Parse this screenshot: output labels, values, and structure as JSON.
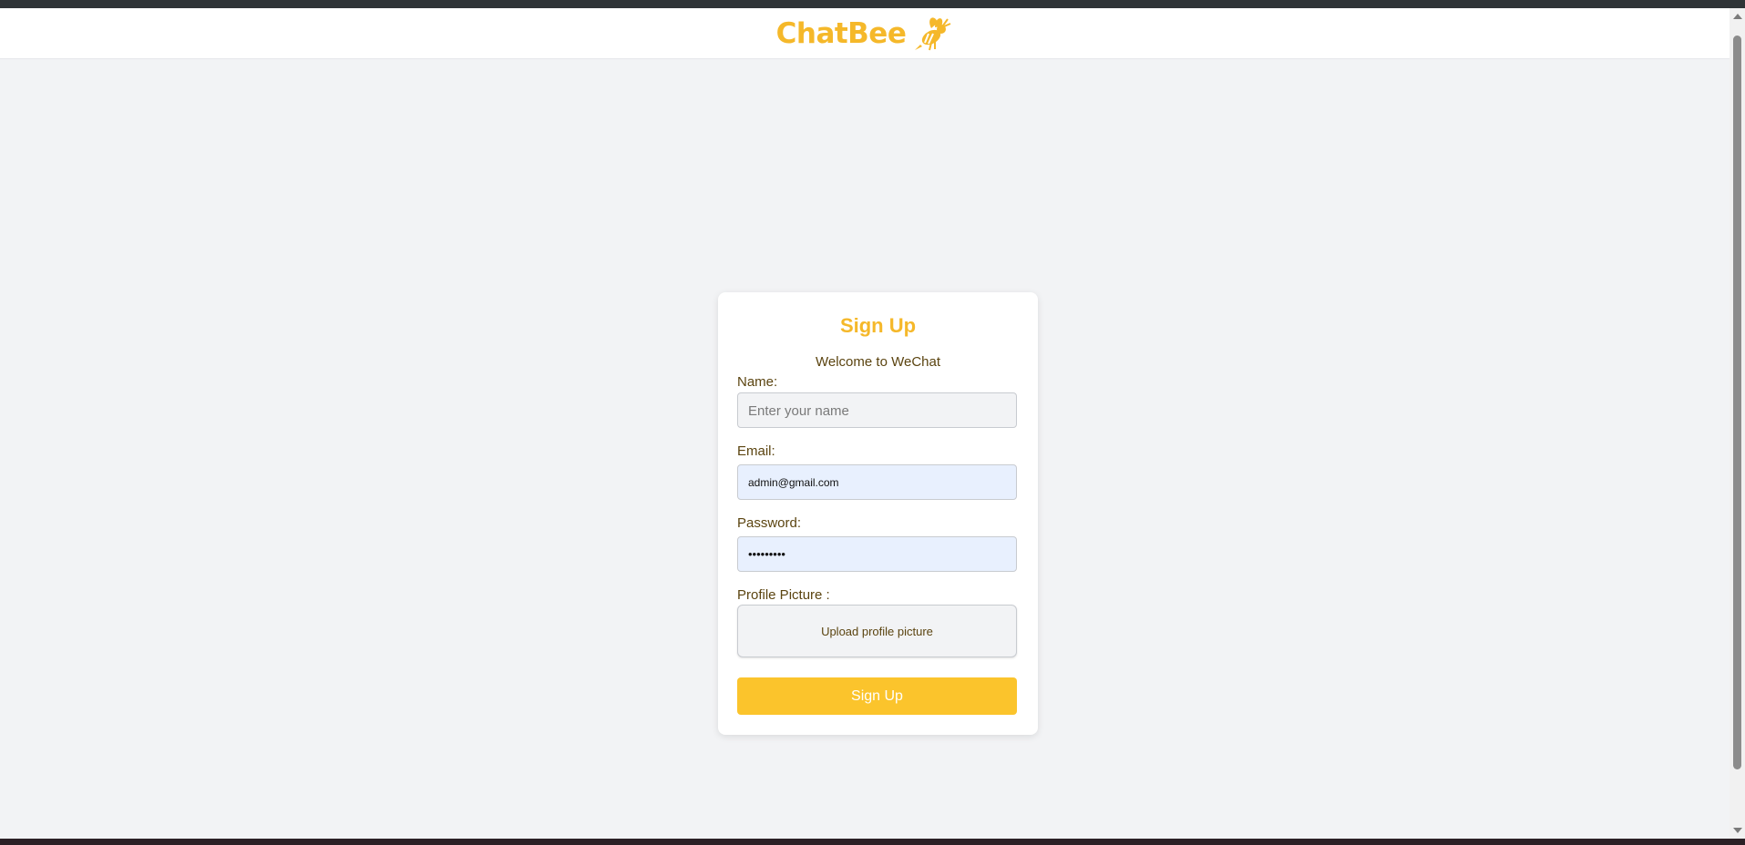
{
  "header": {
    "logo_text": "ChatBee",
    "logo_icon": "bee-icon",
    "brand_color": "#f5b82a"
  },
  "form": {
    "title": "Sign Up",
    "subtitle": "Welcome to WeChat",
    "name": {
      "label": "Name:",
      "placeholder": "Enter your name",
      "value": ""
    },
    "email": {
      "label": "Email:",
      "value": "admin@gmail.com"
    },
    "password": {
      "label": "Password:",
      "value": "•••••••••"
    },
    "profile_picture": {
      "label": "Profile Picture :",
      "upload_label": "Upload profile picture"
    },
    "submit_label": "Sign Up",
    "button_color": "#fbc42c"
  }
}
